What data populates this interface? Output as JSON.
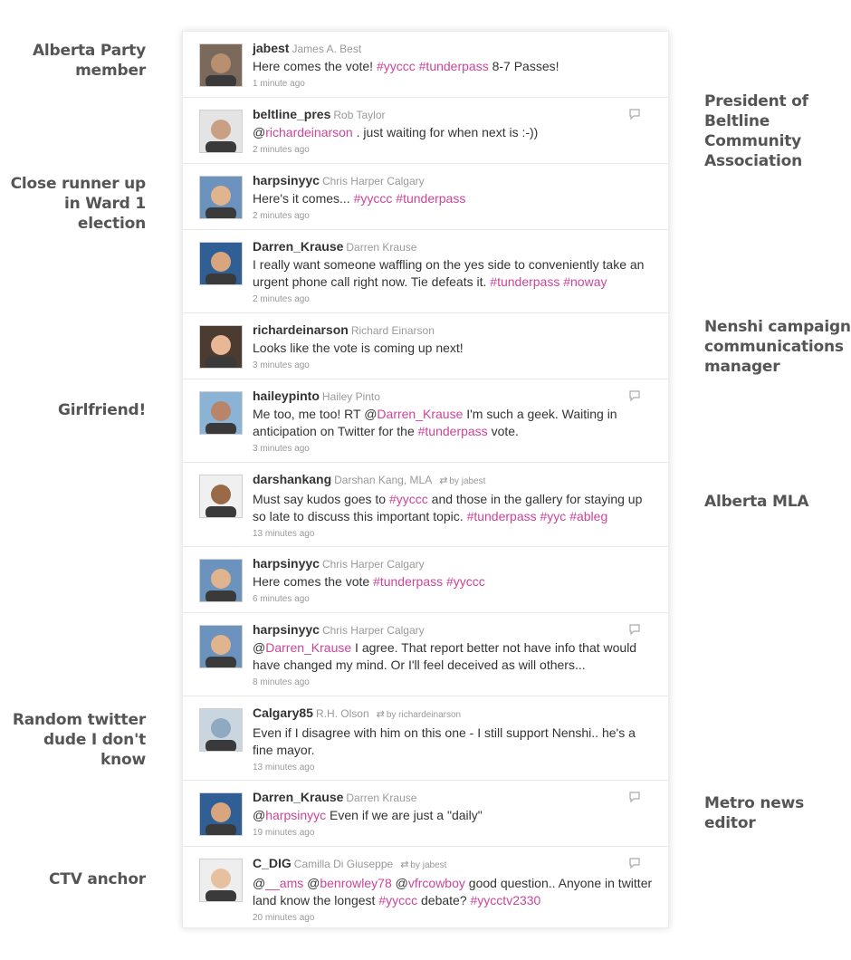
{
  "annotations_left": [
    {
      "lines": [
        "Alberta Party",
        "member"
      ]
    },
    {
      "lines": [
        "Close runner up",
        "in Ward 1 election"
      ]
    },
    {
      "lines": [
        "Girlfriend!"
      ]
    },
    {
      "lines": [
        "Random twitter",
        "dude I don't",
        "know"
      ]
    },
    {
      "lines": [
        "CTV anchor"
      ]
    }
  ],
  "annotations_right": [
    {
      "lines": [
        "President of",
        "Beltline",
        "Community",
        "Association"
      ]
    },
    {
      "lines": [
        "Nenshi campaign",
        "communications",
        "manager"
      ]
    },
    {
      "lines": [
        "Alberta MLA"
      ]
    },
    {
      "lines": [
        "Metro news",
        "editor"
      ]
    }
  ],
  "colors": {
    "link": "#cc4499",
    "handle": "#333333",
    "meta": "#999999"
  },
  "tweets": [
    {
      "handle": "jabest",
      "name": "James A. Best",
      "time": "1 minute ago",
      "reply": false,
      "rt_by": "",
      "body": [
        {
          "t": "Here comes the vote! "
        },
        {
          "t": "#yyccc",
          "link": true
        },
        {
          "t": " "
        },
        {
          "t": "#tunderpass",
          "link": true
        },
        {
          "t": " 8-7 Passes!"
        }
      ]
    },
    {
      "handle": "beltline_pres",
      "name": "Rob Taylor",
      "time": "2 minutes ago",
      "reply": true,
      "rt_by": "",
      "body": [
        {
          "t": "@"
        },
        {
          "t": "richardeinarson",
          "link": true
        },
        {
          "t": " . just waiting for when next is :-))"
        }
      ]
    },
    {
      "handle": "harpsinyyc",
      "name": "Chris Harper Calgary",
      "time": "2 minutes ago",
      "reply": false,
      "rt_by": "",
      "body": [
        {
          "t": "Here's it comes... "
        },
        {
          "t": "#yyccc",
          "link": true
        },
        {
          "t": " "
        },
        {
          "t": "#tunderpass",
          "link": true
        }
      ]
    },
    {
      "handle": "Darren_Krause",
      "name": "Darren Krause",
      "time": "2 minutes ago",
      "reply": false,
      "rt_by": "",
      "body": [
        {
          "t": "I really want someone waffling on the yes side to conveniently take an urgent phone call right now. Tie defeats it. "
        },
        {
          "t": "#tunderpass",
          "link": true
        },
        {
          "t": " "
        },
        {
          "t": "#noway",
          "link": true
        }
      ]
    },
    {
      "handle": "richardeinarson",
      "name": "Richard Einarson",
      "time": "3 minutes ago",
      "reply": false,
      "rt_by": "",
      "body": [
        {
          "t": "Looks like the vote is coming up next!"
        }
      ]
    },
    {
      "handle": "haileypinto",
      "name": "Hailey Pinto",
      "time": "3 minutes ago",
      "reply": true,
      "rt_by": "",
      "body": [
        {
          "t": "Me too, me too! RT @"
        },
        {
          "t": "Darren_Krause",
          "link": true
        },
        {
          "t": " I'm such a geek. Waiting in anticipation on Twitter for the "
        },
        {
          "t": "#tunderpass",
          "link": true
        },
        {
          "t": " vote."
        }
      ]
    },
    {
      "handle": "darshankang",
      "name": "Darshan Kang, MLA",
      "time": "13 minutes ago",
      "reply": false,
      "rt_by": "by jabest",
      "body": [
        {
          "t": "Must say kudos goes to "
        },
        {
          "t": "#yyccc",
          "link": true
        },
        {
          "t": " and those in the gallery for staying up so late to discuss this important topic. "
        },
        {
          "t": "#tunderpass",
          "link": true
        },
        {
          "t": " "
        },
        {
          "t": "#yyc",
          "link": true
        },
        {
          "t": " "
        },
        {
          "t": "#ableg",
          "link": true
        }
      ]
    },
    {
      "handle": "harpsinyyc",
      "name": "Chris Harper Calgary",
      "time": "6 minutes ago",
      "reply": false,
      "rt_by": "",
      "body": [
        {
          "t": "Here comes the vote "
        },
        {
          "t": "#tunderpass",
          "link": true
        },
        {
          "t": " "
        },
        {
          "t": "#yyccc",
          "link": true
        }
      ]
    },
    {
      "handle": "harpsinyyc",
      "name": "Chris Harper Calgary",
      "time": "8 minutes ago",
      "reply": true,
      "rt_by": "",
      "body": [
        {
          "t": "@"
        },
        {
          "t": "Darren_Krause",
          "link": true
        },
        {
          "t": " I agree. That report better not have info that would have changed my mind. Or I'll feel deceived as will others..."
        }
      ]
    },
    {
      "handle": "Calgary85",
      "name": "R.H. Olson",
      "time": "13 minutes ago",
      "reply": false,
      "rt_by": "by richardeinarson",
      "body": [
        {
          "t": "Even if I disagree with him on this one - I still support Nenshi.. he's a fine mayor."
        }
      ]
    },
    {
      "handle": "Darren_Krause",
      "name": "Darren Krause",
      "time": "19 minutes ago",
      "reply": true,
      "rt_by": "",
      "body": [
        {
          "t": "@"
        },
        {
          "t": "harpsinyyc",
          "link": true
        },
        {
          "t": " Even if we are just a \"daily\""
        }
      ]
    },
    {
      "handle": "C_DIG",
      "name": "Camilla Di Giuseppe",
      "time": "20 minutes ago",
      "reply": true,
      "rt_by": "by jabest",
      "body": [
        {
          "t": "@"
        },
        {
          "t": "__ams",
          "link": true
        },
        {
          "t": " @"
        },
        {
          "t": "benrowley78",
          "link": true
        },
        {
          "t": " @"
        },
        {
          "t": "vfrcowboy",
          "link": true
        },
        {
          "t": " good question.. Anyone in twitter land know the longest "
        },
        {
          "t": "#yyccc",
          "link": true
        },
        {
          "t": " debate? "
        },
        {
          "t": "#yycctv2330",
          "link": true
        }
      ]
    }
  ]
}
